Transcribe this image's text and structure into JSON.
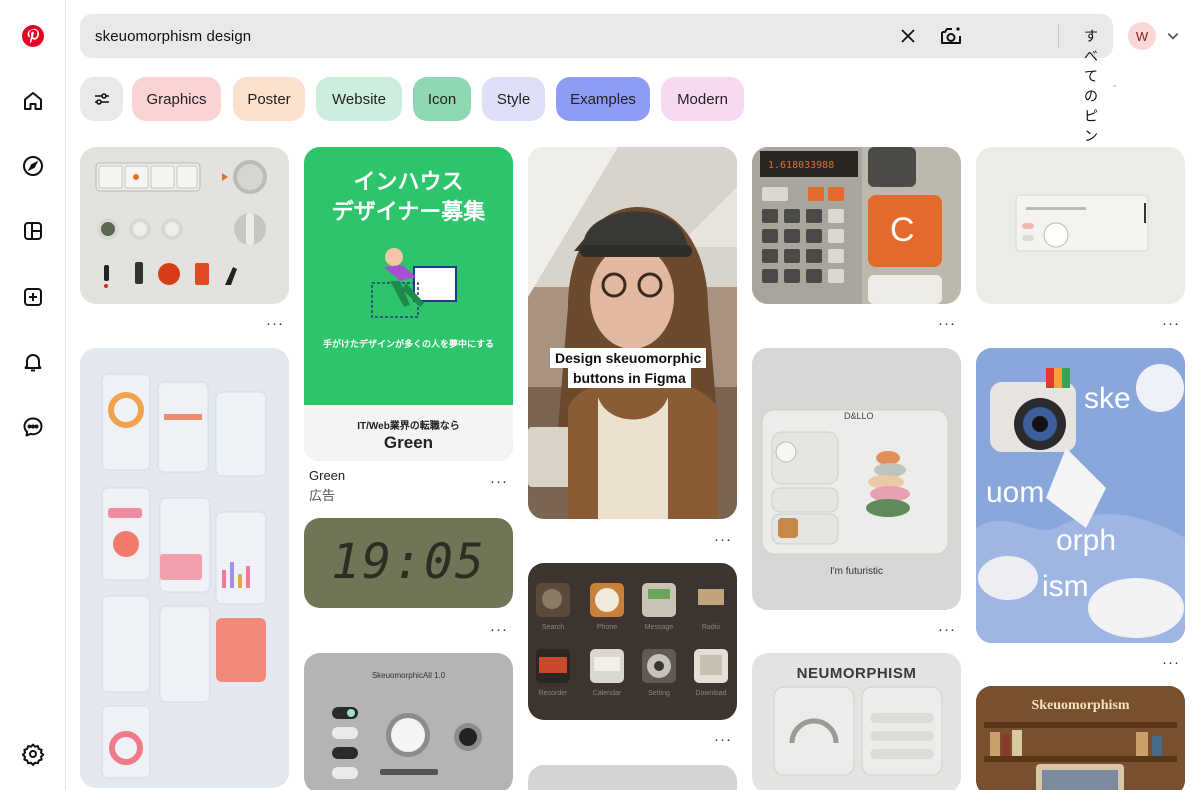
{
  "search": {
    "query": "skeuomorphism design",
    "scope_label": "すべてのピン"
  },
  "user": {
    "avatar_initial": "W"
  },
  "chips": [
    {
      "label": "Graphics",
      "color": "#fbd3d3"
    },
    {
      "label": "Poster",
      "color": "#fde1cf"
    },
    {
      "label": "Website",
      "color": "#cdeedc"
    },
    {
      "label": "Icon",
      "color": "#8fd8b1"
    },
    {
      "label": "Style",
      "color": "#dfe0f7"
    },
    {
      "label": "Examples",
      "color": "#8f9cf4"
    },
    {
      "label": "Modern",
      "color": "#f8d9f2"
    }
  ],
  "sidebar": {
    "items": [
      "pinterest-logo",
      "home",
      "explore",
      "boards",
      "create",
      "notifications",
      "messages",
      "settings"
    ]
  },
  "pins": {
    "more_label": "···",
    "ad": {
      "headline_line1": "インハウス",
      "headline_line2": "デザイナー募集",
      "tagline": "手がけたデザインが多くの人を夢中にする",
      "footer_small": "IT/Web業界の転職なら",
      "footer_brand": "Green",
      "caption_title": "Green",
      "caption_sub": "広告"
    },
    "clock_time": "19:05",
    "figma_line1": "Design skeuomorphic",
    "figma_line2": "buttons in Figma",
    "futuristic_caption": "I'm futuristic",
    "futuristic_brand": "D&LLO",
    "neu_title": "NEUMORPHISM",
    "poster_text": [
      "ske",
      "uom",
      "orph",
      "ism"
    ],
    "book_title": "Skeuomorphism",
    "icon_labels": [
      "Search",
      "Phone",
      "Message",
      "Radio",
      "Recorder",
      "Calendar",
      "Setting",
      "Download"
    ],
    "calc_display": "1.618033988",
    "calc_key": "C",
    "audio_title": "SkeuomorphicAll 1.0"
  }
}
